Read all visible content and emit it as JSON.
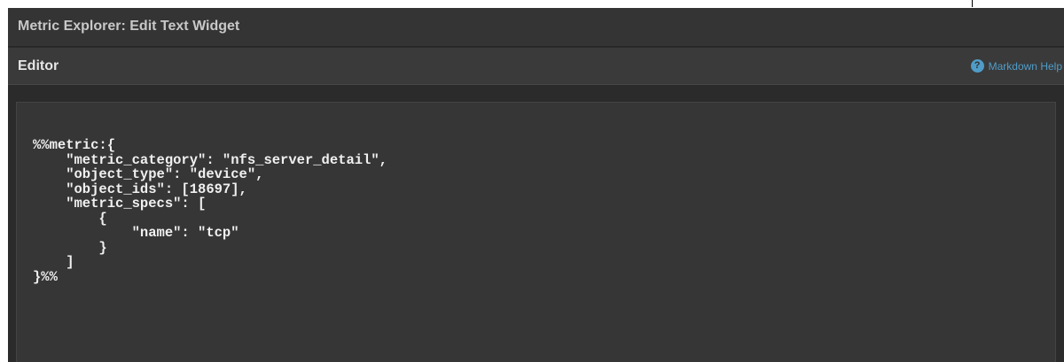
{
  "window": {
    "title": "Metric Explorer: Edit Text Widget"
  },
  "section": {
    "title": "Editor",
    "help_label": "Markdown Help",
    "help_icon": "question-circle-icon"
  },
  "editor": {
    "content": "%%metric:{\n    \"metric_category\": \"nfs_server_detail\",\n    \"object_type\": \"device\",\n    \"object_ids\": [18697],\n    \"metric_specs\": [\n        {\n            \"name\": \"tcp\"\n        }\n    ]\n}%%"
  },
  "colors": {
    "background": "#2b2b2b",
    "title_bar": "#343434",
    "section_bar": "#3a3a3a",
    "editor_bg": "#363636",
    "link": "#4f9cc8",
    "text": "#f0f0f0"
  }
}
